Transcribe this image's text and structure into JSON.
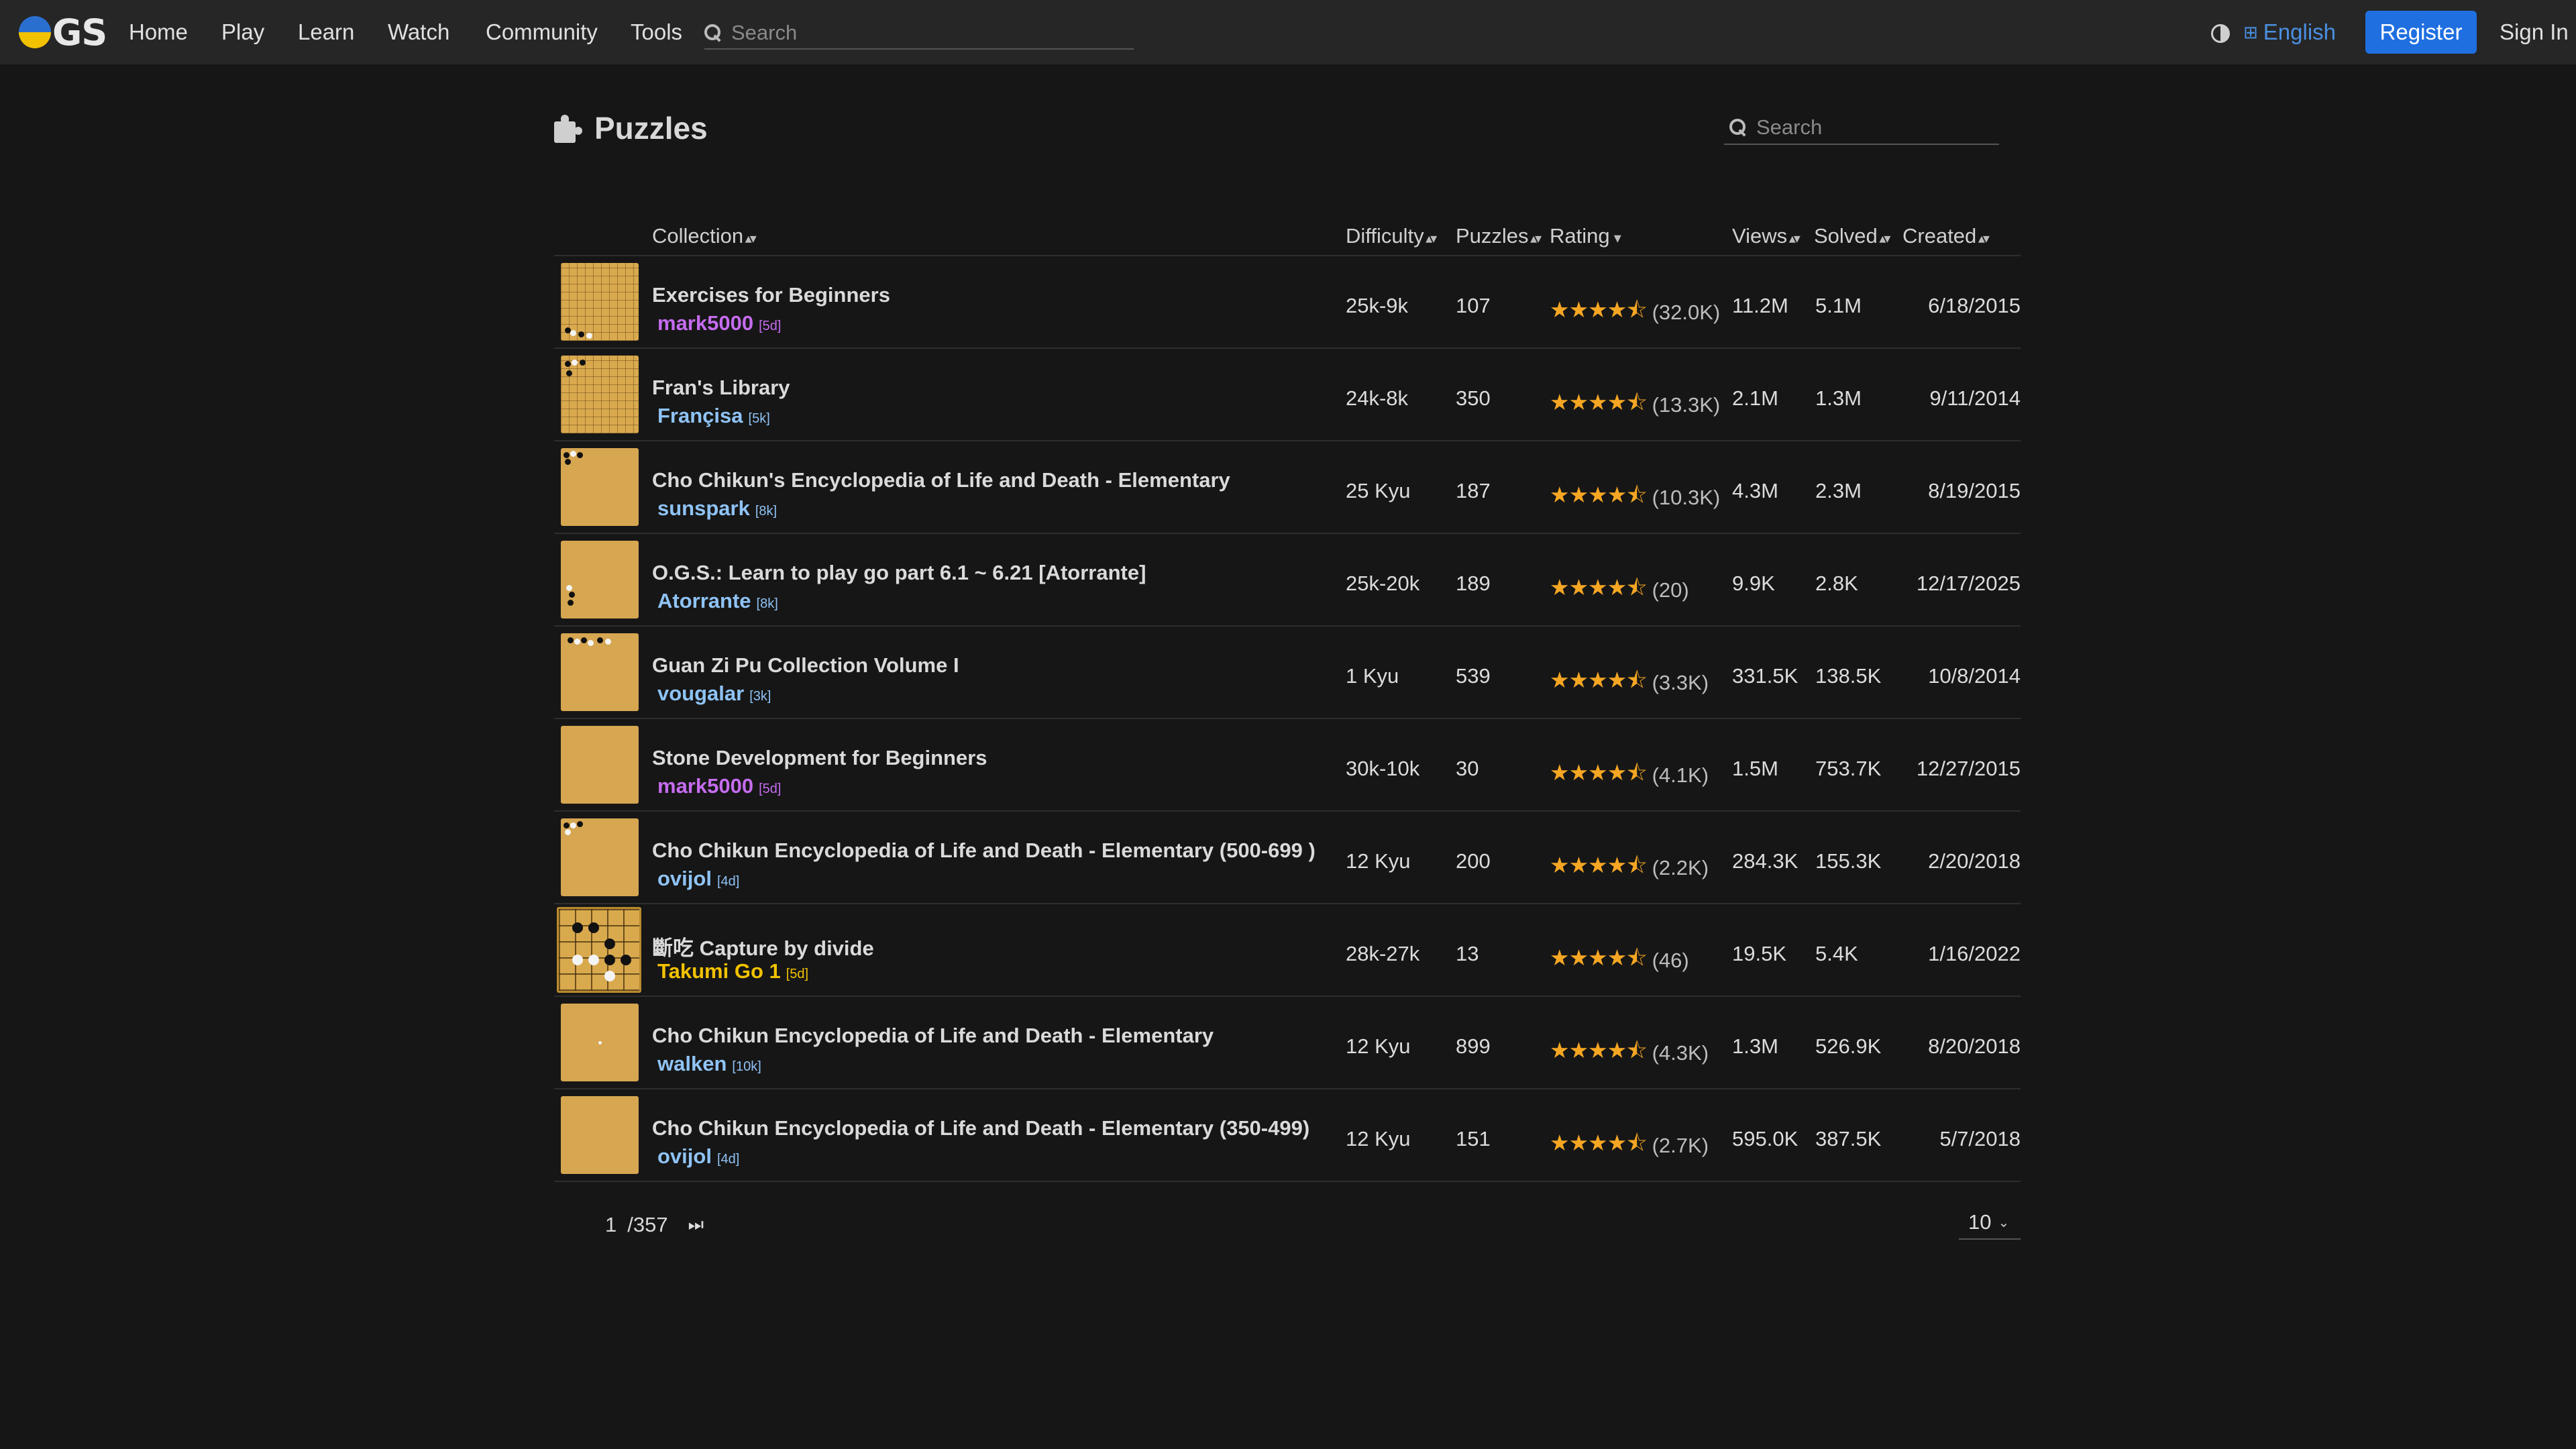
{
  "nav": {
    "logo_text": "GS",
    "items": [
      "Home",
      "Play",
      "Learn",
      "Watch",
      "Community",
      "Tools"
    ],
    "search_placeholder": "Search",
    "language": "English",
    "register_label": "Register",
    "signin_label": "Sign In"
  },
  "page": {
    "title": "Puzzles",
    "search_placeholder": "Search"
  },
  "table": {
    "headers": {
      "collection": "Collection",
      "difficulty": "Difficulty",
      "puzzles": "Puzzles",
      "rating": "Rating",
      "views": "Views",
      "solved": "Solved",
      "created": "Created"
    },
    "rows": [
      {
        "name": "Exercises for Beginners",
        "owner": "mark5000",
        "rank": "[5d]",
        "owner_color": "#c56cf0",
        "difficulty": "25k-9k",
        "puzzles": "107",
        "stars": "★★★★⯪",
        "rating_count": "(32.0K)",
        "views": "11.2M",
        "solved": "5.1M",
        "created": "6/18/2015"
      },
      {
        "name": "Fran's Library",
        "owner": "Françisa",
        "rank": "[5k]",
        "owner_color": "#8fc3f5",
        "difficulty": "24k-8k",
        "puzzles": "350",
        "stars": "★★★★⯪",
        "rating_count": "(13.3K)",
        "views": "2.1M",
        "solved": "1.3M",
        "created": "9/11/2014"
      },
      {
        "name": "Cho Chikun's Encyclopedia of Life and Death - Elementary",
        "owner": "sunspark",
        "rank": "[8k]",
        "owner_color": "#8fc3f5",
        "difficulty": "25 Kyu",
        "puzzles": "187",
        "stars": "★★★★⯪",
        "rating_count": "(10.3K)",
        "views": "4.3M",
        "solved": "2.3M",
        "created": "8/19/2015"
      },
      {
        "name": "O.G.S.: Learn to play go part 6.1 ~ 6.21 [Atorrante]",
        "owner": "Atorrante",
        "rank": "[8k]",
        "owner_color": "#8fc3f5",
        "difficulty": "25k-20k",
        "puzzles": "189",
        "stars": "★★★★⯪",
        "rating_count": "(20)",
        "views": "9.9K",
        "solved": "2.8K",
        "created": "12/17/2025"
      },
      {
        "name": "Guan Zi Pu Collection Volume I",
        "owner": "vougalar",
        "rank": "[3k]",
        "owner_color": "#8fc3f5",
        "difficulty": "1 Kyu",
        "puzzles": "539",
        "stars": "★★★★⯪",
        "rating_count": "(3.3K)",
        "views": "331.5K",
        "solved": "138.5K",
        "created": "10/8/2014"
      },
      {
        "name": "Stone Development for Beginners",
        "owner": "mark5000",
        "rank": "[5d]",
        "owner_color": "#c56cf0",
        "difficulty": "30k-10k",
        "puzzles": "30",
        "stars": "★★★★⯪",
        "rating_count": "(4.1K)",
        "views": "1.5M",
        "solved": "753.7K",
        "created": "12/27/2015"
      },
      {
        "name": "Cho Chikun Encyclopedia of Life and Death - Elementary (500-699 )",
        "owner": "ovijol",
        "rank": "[4d]",
        "owner_color": "#8fc3f5",
        "difficulty": "12 Kyu",
        "puzzles": "200",
        "stars": "★★★★⯪",
        "rating_count": "(2.2K)",
        "views": "284.3K",
        "solved": "155.3K",
        "created": "2/20/2018"
      },
      {
        "name": "斷吃 Capture by divide",
        "owner": "Takumi Go 1",
        "rank": "[5d]",
        "owner_color": "#f2c200",
        "difficulty": "28k-27k",
        "puzzles": "13",
        "stars": "★★★★⯪",
        "rating_count": "(46)",
        "views": "19.5K",
        "solved": "5.4K",
        "created": "1/16/2022"
      },
      {
        "name": "Cho Chikun Encyclopedia of Life and Death - Elementary",
        "owner": "walken",
        "rank": "[10k]",
        "owner_color": "#8fc3f5",
        "difficulty": "12 Kyu",
        "puzzles": "899",
        "stars": "★★★★⯪",
        "rating_count": "(4.3K)",
        "views": "1.3M",
        "solved": "526.9K",
        "created": "8/20/2018"
      },
      {
        "name": "Cho Chikun Encyclopedia of Life and Death - Elementary (350-499)",
        "owner": "ovijol",
        "rank": "[4d]",
        "owner_color": "#8fc3f5",
        "difficulty": "12 Kyu",
        "puzzles": "151",
        "stars": "★★★★⯪",
        "rating_count": "(2.7K)",
        "views": "595.0K",
        "solved": "387.5K",
        "created": "5/7/2018"
      }
    ]
  },
  "pager": {
    "current": "1",
    "total": "/357",
    "page_size": "10"
  },
  "icons": {
    "search": "search-icon",
    "theme": "contrast-icon",
    "language": "language-icon",
    "puzzle": "puzzle-icon",
    "last_page": "last-page-icon",
    "dropdown": "chevron-down-icon"
  }
}
